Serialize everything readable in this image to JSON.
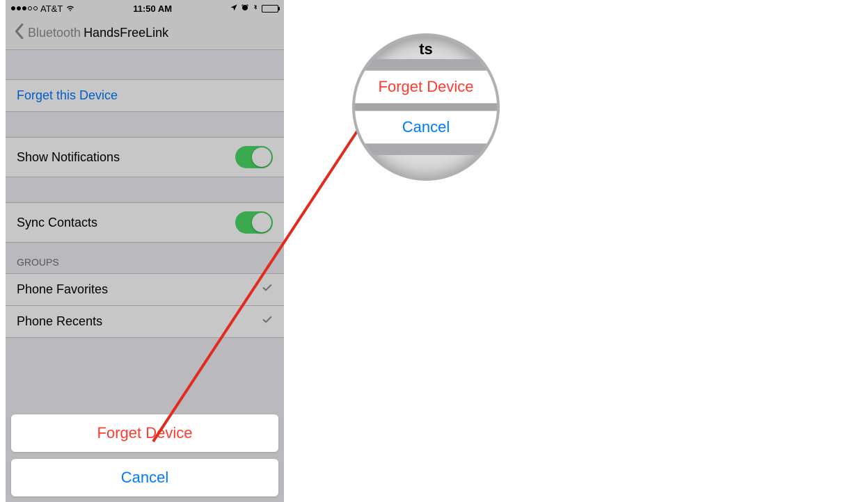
{
  "status_bar": {
    "carrier": "AT&T",
    "time": "11:50 AM"
  },
  "nav": {
    "back_label": "Bluetooth",
    "title": "HandsFreeLink"
  },
  "settings": {
    "forget_link": "Forget this Device",
    "show_notifications": "Show Notifications",
    "sync_contacts": "Sync Contacts",
    "groups_header": "GROUPS",
    "phone_favorites": "Phone Favorites",
    "phone_recents": "Phone Recents"
  },
  "action_sheet": {
    "forget": "Forget Device",
    "cancel": "Cancel"
  },
  "callout": {
    "partial_text": "ts",
    "forget": "Forget Device",
    "cancel": "Cancel"
  },
  "colors": {
    "destructive": "#ff3b30",
    "link": "#007aff",
    "toggle_on": "#4cd964"
  }
}
